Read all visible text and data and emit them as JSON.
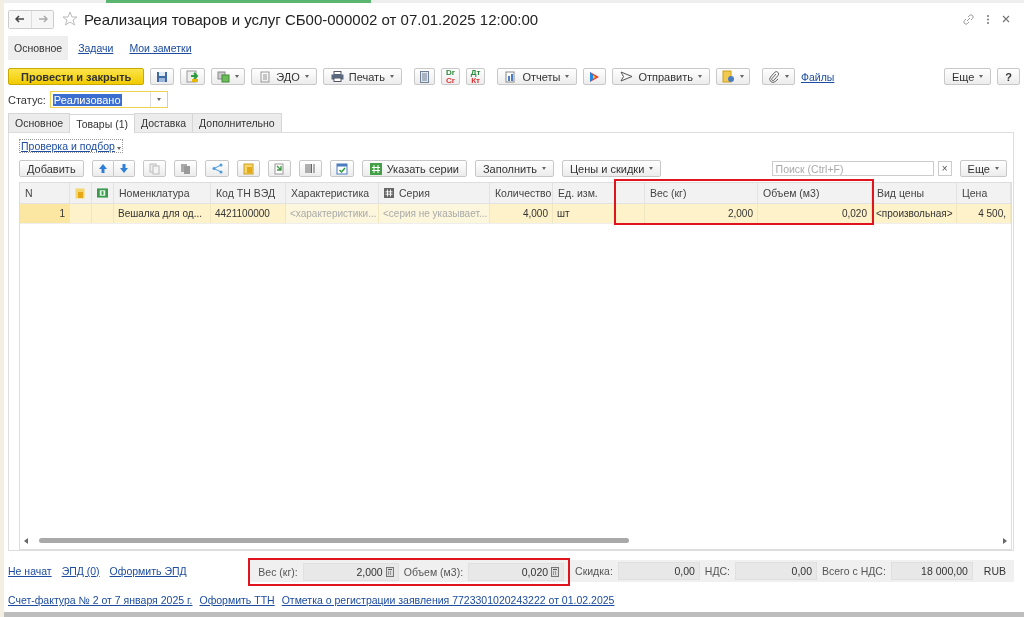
{
  "window": {
    "title": "Реализация товаров и услуг СБ00-000002 от 07.01.2025 12:00:00",
    "favorite": false
  },
  "sections": [
    {
      "label": "Основное",
      "selected": true
    },
    {
      "label": "Задачи",
      "selected": false
    },
    {
      "label": "Мои заметки",
      "selected": false
    }
  ],
  "toolbar": {
    "post_close": "Провести и закрыть",
    "edo": "ЭДО",
    "print": "Печать",
    "dr_cr": [
      "Dr",
      "Cr"
    ],
    "dt_kt": [
      "Дт",
      "Кт"
    ],
    "reports": "Отчеты",
    "send": "Отправить",
    "files": "Файлы",
    "more": "Еще",
    "help": "?"
  },
  "status": {
    "label": "Статус:",
    "value": "Реализовано"
  },
  "tabs": [
    {
      "label": "Основное",
      "selected": false
    },
    {
      "label": "Товары (1)",
      "selected": true
    },
    {
      "label": "Доставка",
      "selected": false
    },
    {
      "label": "Дополнительно",
      "selected": false
    }
  ],
  "check_link": "Проверка и подбор",
  "table_toolbar": {
    "add": "Добавить",
    "set_series": "Указать серии",
    "fill": "Заполнить",
    "prices": "Цены и скидки",
    "search": {
      "placeholder": "Поиск (Ctrl+F)",
      "clear": "×"
    },
    "more": "Еще"
  },
  "table": {
    "columns": [
      "N",
      "",
      "",
      "Номенклатура",
      "Код ТН ВЭД",
      "Характеристика",
      "Серия",
      "Количество",
      "Ед. изм.",
      "",
      "Вес (кг)",
      "Объем (м3)",
      "Вид цены",
      "Цена"
    ],
    "rows": [
      {
        "selected": true,
        "cells": [
          {
            "text": "1",
            "muted": false
          },
          {
            "text": "",
            "muted": false
          },
          {
            "text": "",
            "muted": false
          },
          {
            "text": "Вешалка для од...",
            "muted": false
          },
          {
            "text": "4421100000",
            "muted": false
          },
          {
            "text": "<характеристики...",
            "muted": true
          },
          {
            "text": "<серия не указывает...",
            "muted": true
          },
          {
            "text": "4,000",
            "muted": false
          },
          {
            "text": "шт",
            "muted": false
          },
          {
            "text": "",
            "muted": false
          },
          {
            "text": "2,000",
            "muted": false
          },
          {
            "text": "0,020",
            "muted": false
          },
          {
            "text": "<произвольная>",
            "muted": false
          },
          {
            "text": "4 500,",
            "muted": false
          }
        ]
      }
    ]
  },
  "footer_links": [
    "Не начат",
    "ЭПД (0)",
    "Оформить ЭПД"
  ],
  "totals": [
    {
      "label": "Вес (кг):",
      "value": "2,000",
      "kind": "calc"
    },
    {
      "label": "Объем (м3):",
      "value": "0,020",
      "kind": "calc"
    },
    {
      "label": "Скидка:",
      "value": "0,00",
      "kind": "plain"
    },
    {
      "label": "НДС:",
      "value": "0,00",
      "kind": "plain"
    },
    {
      "label": "Всего с НДС:",
      "value": "18 000,00",
      "kind": "plain"
    }
  ],
  "currency": "RUB",
  "bottom_links": [
    "Счет-фактура № 2 от 7 января 2025 г.",
    "Оформить ТТН",
    "Отметка о регистрации заявления 7723301020243222 от 01.02.2025"
  ]
}
